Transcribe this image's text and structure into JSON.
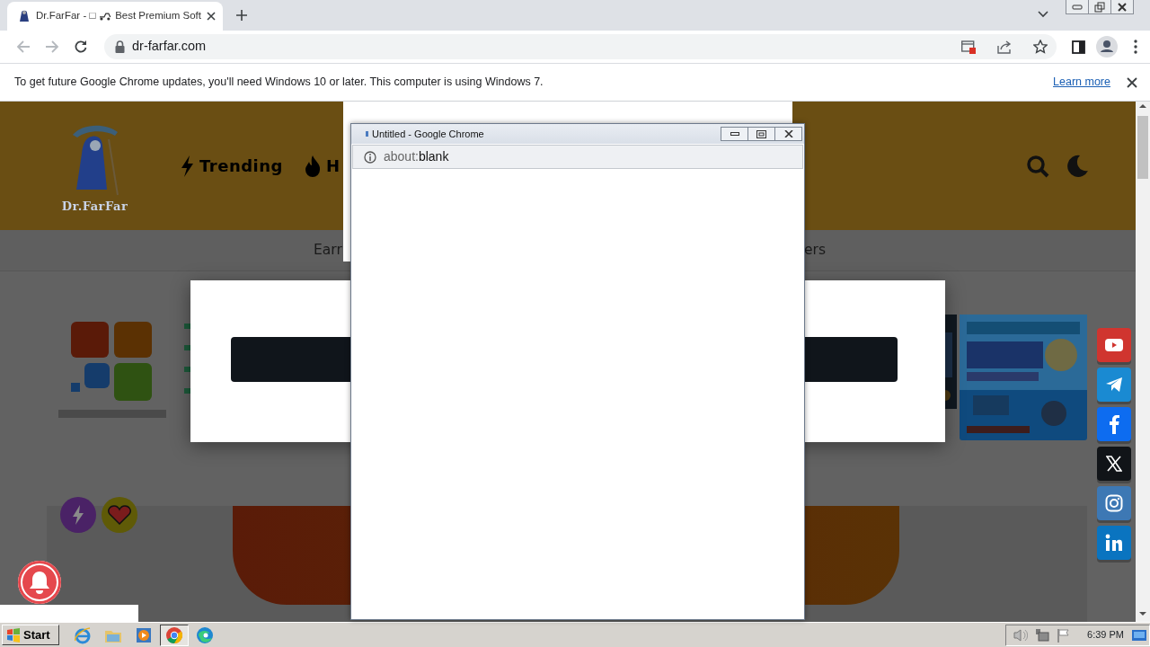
{
  "browser": {
    "tabs": [
      {
        "title": "Dr.FarFar - □",
        "title_rest": "Best Premium Soft",
        "selected": true
      }
    ],
    "address": "dr-farfar.com"
  },
  "infobar": {
    "message": "To get future Google Chrome updates, you'll need Windows 10 or later. This computer is using Windows 7.",
    "link": "Learn more"
  },
  "site": {
    "logo_text": "Dr.FarFar",
    "nav": [
      {
        "kind": "bolt",
        "label": "Trending"
      },
      {
        "kind": "fire",
        "label": "H"
      }
    ],
    "menu": [
      "Earr",
      "ers"
    ]
  },
  "social": [
    {
      "kind": "youtube",
      "color": "#d0352f"
    },
    {
      "kind": "telegram",
      "color": "#1a8ad2"
    },
    {
      "kind": "facebook",
      "color": "#0d6cf0"
    },
    {
      "kind": "x",
      "color": "#111418"
    },
    {
      "kind": "instagram",
      "color": "#3d78b4"
    },
    {
      "kind": "linkedin",
      "color": "#0a74c0"
    }
  ],
  "popup": {
    "title": "Untitled - Google Chrome",
    "address_scheme": "about:",
    "address_rest": "blank"
  },
  "taskbar": {
    "start": "Start",
    "apps": [
      {
        "kind": "ie",
        "selected": false
      },
      {
        "kind": "explorer",
        "selected": false
      },
      {
        "kind": "media",
        "selected": false
      },
      {
        "kind": "chrome",
        "selected": true
      },
      {
        "kind": "edge",
        "selected": false
      }
    ],
    "clock": "6:39 PM"
  }
}
